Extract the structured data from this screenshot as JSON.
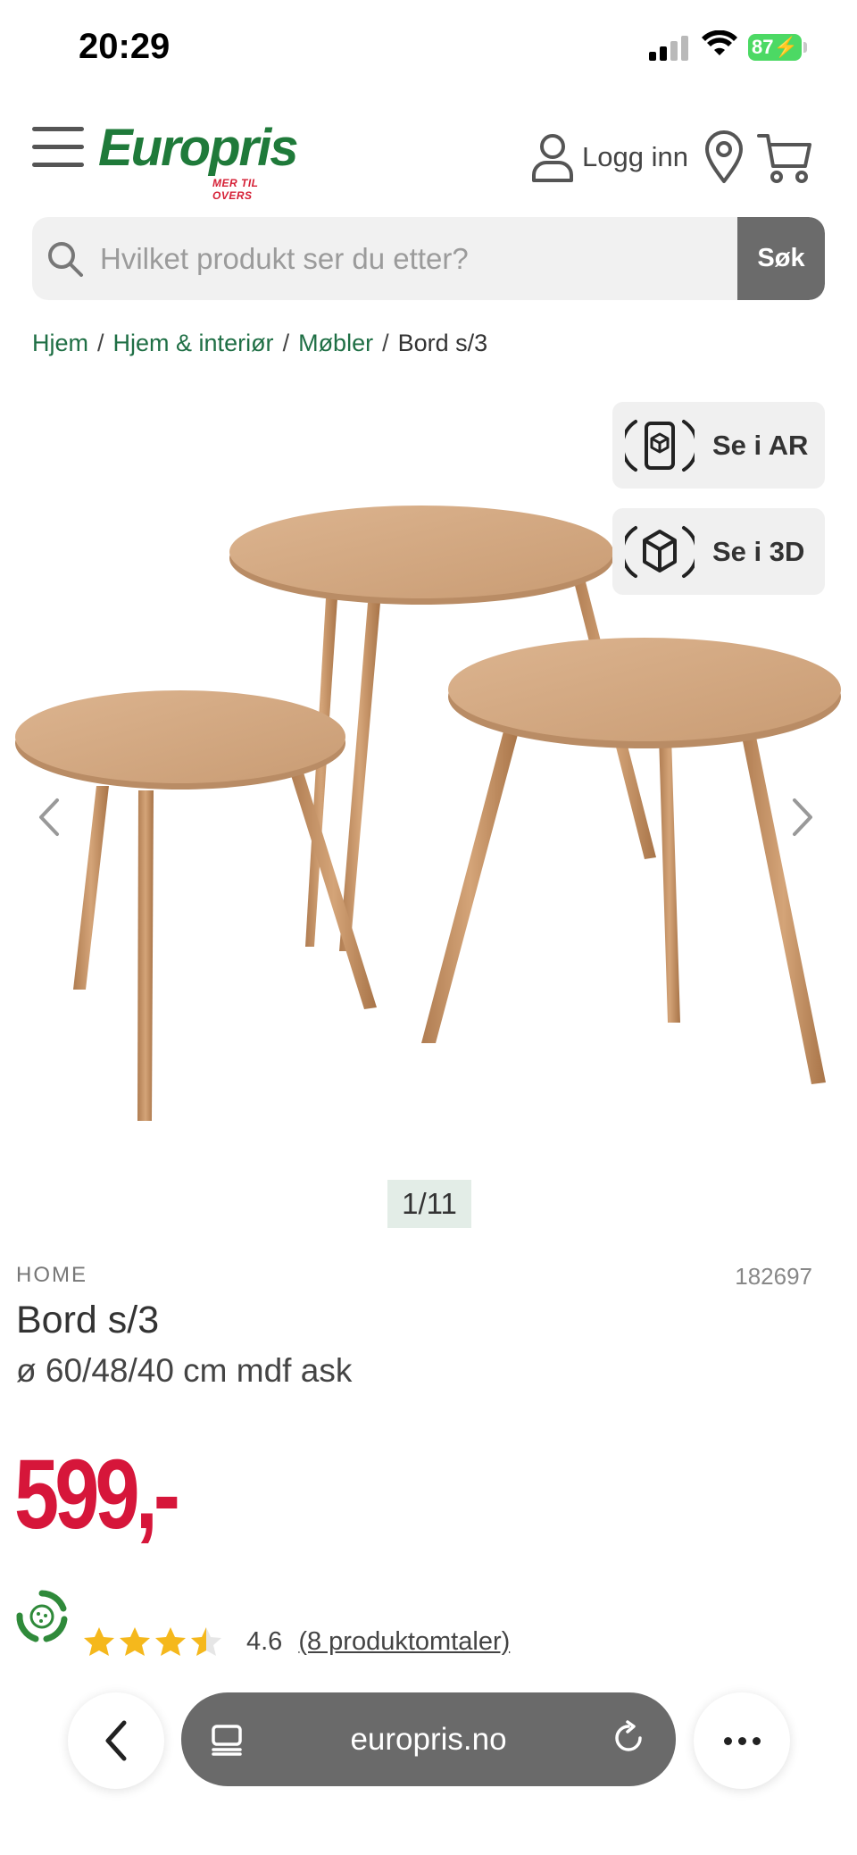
{
  "status_bar": {
    "time": "20:29",
    "battery": "87"
  },
  "header": {
    "logo_text": "Europris",
    "logo_tagline": "MER TIL OVERS",
    "login_label": "Logg inn",
    "brand_green": "#1f7a3a",
    "brand_red": "#d51f35"
  },
  "search": {
    "placeholder": "Hvilket produkt ser du etter?",
    "button_label": "Søk"
  },
  "breadcrumb": {
    "items": [
      "Hjem",
      "Hjem & interiør",
      "Møbler"
    ],
    "separator": "/",
    "current": "Bord s/3"
  },
  "gallery": {
    "ar_label": "Se i AR",
    "threed_label": "Se i 3D",
    "counter": "1/11"
  },
  "product": {
    "brand": "HOME",
    "sku": "182697",
    "title": "Bord s/3",
    "subtitle": "ø 60/48/40 cm mdf ask",
    "price": "599,-",
    "rating_value": "4.6",
    "rating_stars": 3.5,
    "reviews_label": "(8 produktomtaler)",
    "price_color": "#d6163a"
  },
  "browser": {
    "url": "europris.no"
  },
  "icons": [
    "menu-icon",
    "user-icon",
    "location-pin-icon",
    "cart-icon",
    "search-icon",
    "ar-phone-icon",
    "cube-3d-icon",
    "chevron-left-icon",
    "chevron-right-icon",
    "eco-recycle-icon",
    "star-icon",
    "back-chevron-icon",
    "tabs-icon",
    "reload-icon",
    "more-dots-icon"
  ]
}
